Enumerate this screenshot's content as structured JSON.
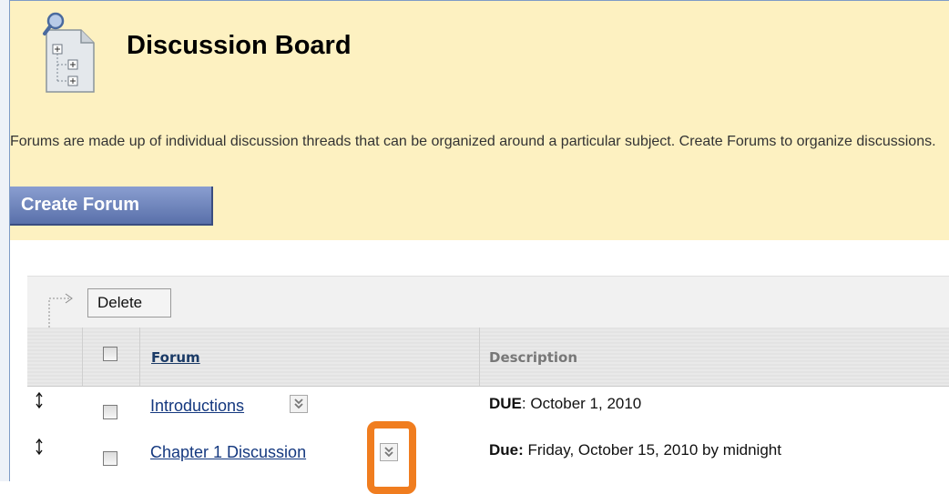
{
  "header": {
    "title": "Discussion Board",
    "description": "Forums are made up of individual discussion threads that can be organized around a particular subject. Create Forums to organize discussions.",
    "create_button_label": "Create Forum",
    "icon": "discussion-board-icon"
  },
  "toolbar": {
    "delete_label": "Delete",
    "icon": "action-arrow-icon"
  },
  "table": {
    "columns": [
      "Forum",
      "Description"
    ],
    "rows": [
      {
        "forum": "Introductions",
        "due_label": "DUE",
        "due_text": ": October 1, 2010"
      },
      {
        "forum": "Chapter 1 Discussion",
        "due_label": "Due:",
        "due_text": " Friday, October 15, 2010 by midnight"
      }
    ]
  },
  "colors": {
    "header_bg": "#fdf1c1",
    "button_bg": "#6a7fb8",
    "link": "#14387f",
    "highlight": "#f07d1f"
  }
}
